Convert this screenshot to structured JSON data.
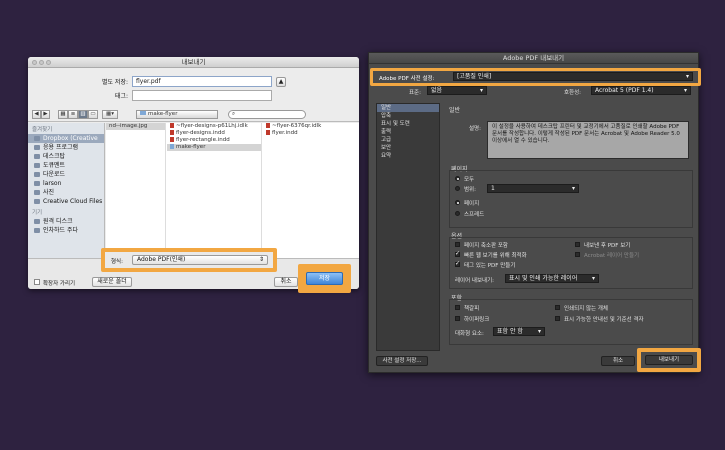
{
  "save_dialog": {
    "title": "내보내기",
    "save_as_label": "별도 저장:",
    "save_as_value": "flyer.pdf",
    "tags_label": "태그:",
    "location": "make-flyer",
    "search_placeholder": "",
    "sidebar": {
      "favorites_header": "즐겨찾기",
      "favorites": [
        "Dropbox (Creative",
        "응용 프로그램",
        "데스크탑",
        "도큐멘트",
        "다운로드",
        "larson",
        "사진",
        "Creative Cloud Files"
      ],
      "devices_header": "기기",
      "devices": [
        "원격 디스크",
        "인차하드 주다"
      ]
    },
    "columns": [
      [
        "nd--image.jpg"
      ],
      [
        "~flyer-designs-p61Lhj.idlk",
        "flyer-designs.indd",
        "flyer-rectangle.indd",
        "make-flyer"
      ],
      [
        "~flyer-6376qr.idlk",
        "flyer.indd"
      ]
    ],
    "format_label": "형식:",
    "format_value": "Adobe PDF(인쇄)",
    "hide_ext_label": "확장자 가리기",
    "new_folder_label": "새로운 폴더",
    "cancel_label": "취소",
    "save_label": "저장"
  },
  "pdf_dialog": {
    "title": "Adobe PDF 내보내기",
    "preset_label": "Adobe PDF 사전 설정:",
    "preset_value": "[고품질 인쇄]",
    "standard_label": "표준:",
    "standard_value": "없음",
    "compat_label": "호환성:",
    "compat_value": "Acrobat 5 (PDF 1.4)",
    "nav_items": [
      "일반",
      "압축",
      "표시 및 도련",
      "출력",
      "고급",
      "보안",
      "요약"
    ],
    "section_general": "일반",
    "desc_label": "설명:",
    "desc_text": "이 설정을 사용하여 데스크탑 프린터 및 교정기에서 고품질로 인쇄할 Adobe PDF 문서를 작성합니다. 이렇게 작성된 PDF 문서는 Acrobat 및 Adobe Reader 5.0 이상에서 열 수 있습니다.",
    "pages_header": "페이지",
    "all_label": "모두",
    "range_label": "범위:",
    "range_value": "1",
    "pages_label": "페이지",
    "spreads_label": "스프레드",
    "options_header": "옵션",
    "opt_embed_thumbs": "페이지 축소판 포함",
    "opt_view_after": "내보낸 후 PDF 보기",
    "opt_fast_web": "빠른 웹 보기를 위해 최적화",
    "opt_acrobat_layers": "Acrobat 레이어 만들기",
    "opt_tagged": "태그 있는 PDF 만들기",
    "layers_label": "레이어 내보내기:",
    "layers_value": "표시 및 인쇄 가능한 레이어",
    "include_header": "포함",
    "inc_bookmarks": "책갈피",
    "inc_hyperlinks": "하이퍼링크",
    "inc_nonprinting": "인쇄되지 않는 개체",
    "inc_guides": "표시 가능한 안내선 및 기준선 격자",
    "interactive_label": "대화형 요소:",
    "interactive_value": "표함 안 함",
    "save_preset_label": "사전 설정 저장...",
    "cancel_label": "취소",
    "export_label": "내보내기"
  },
  "colors": {
    "highlight": "#f2a742",
    "background": "#2e2240"
  }
}
